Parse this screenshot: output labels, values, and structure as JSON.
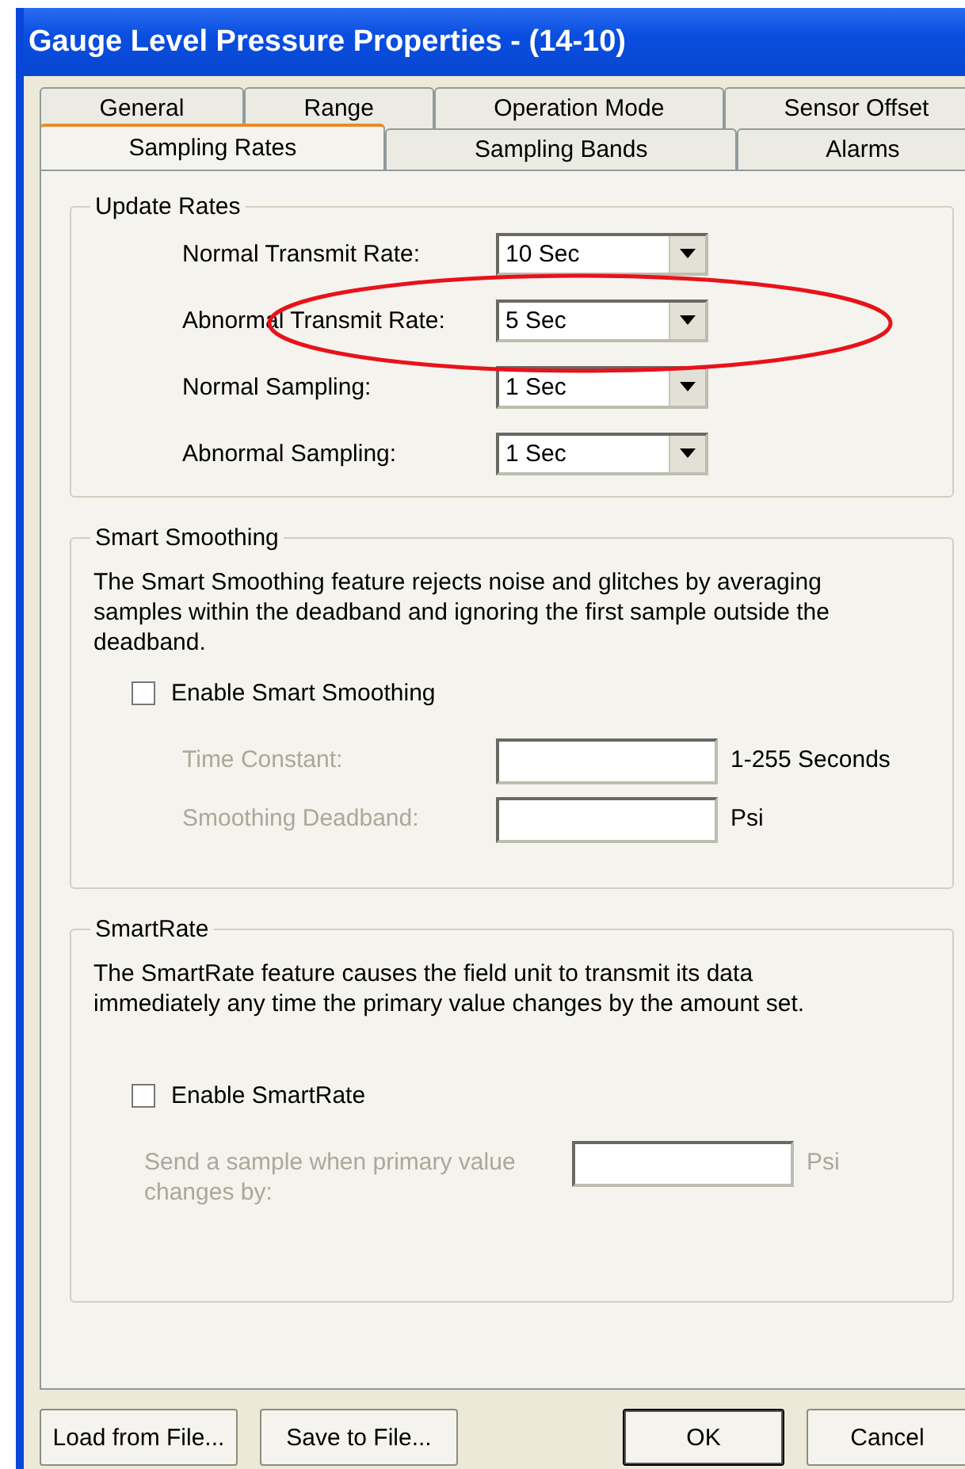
{
  "window": {
    "title": "Gauge Level Pressure Properties -  (14-10)"
  },
  "tab_rows": [
    {
      "tabs": [
        {
          "label": "General",
          "selected": false
        },
        {
          "label": "Range",
          "selected": false
        },
        {
          "label": "Operation Mode",
          "selected": false
        },
        {
          "label": "Sensor Offset",
          "selected": false
        }
      ]
    },
    {
      "tabs": [
        {
          "label": "Sampling Rates",
          "selected": true
        },
        {
          "label": "Sampling Bands",
          "selected": false
        },
        {
          "label": "Alarms",
          "selected": false
        }
      ]
    }
  ],
  "update_rates": {
    "title": "Update Rates",
    "rows": [
      {
        "label": "Normal Transmit Rate:",
        "value": "10 Sec"
      },
      {
        "label": "Abnormal Transmit Rate:",
        "value": "5 Sec"
      },
      {
        "label": "Normal Sampling:",
        "value": "1 Sec"
      },
      {
        "label": "Abnormal Sampling:",
        "value": "1 Sec"
      }
    ]
  },
  "smart_smoothing": {
    "title": "Smart Smoothing",
    "description": "The Smart Smoothing feature rejects noise and glitches by averaging samples within the deadband and ignoring the first sample outside the deadband.",
    "checkbox": {
      "label": "Enable Smart Smoothing",
      "checked": false
    },
    "fields": [
      {
        "label": "Time Constant:",
        "disabled": true,
        "unit": "1-255 Seconds",
        "unit_disabled": false
      },
      {
        "label": "Smoothing Deadband:",
        "disabled": true,
        "unit": "Psi",
        "unit_disabled": false
      }
    ]
  },
  "smart_rate": {
    "title": "SmartRate",
    "description": "The SmartRate feature causes the field unit to transmit its data immediately any time the primary value changes by the amount set.",
    "checkbox": {
      "label": "Enable SmartRate",
      "checked": false
    },
    "fields": [
      {
        "label": "Send a sample when primary value changes by:",
        "disabled": true,
        "unit": "Psi",
        "unit_disabled": true
      }
    ]
  },
  "buttons": [
    {
      "label": "Load from File...",
      "default": false
    },
    {
      "label": "Save to File...",
      "default": false
    },
    {
      "label": "OK",
      "default": true
    },
    {
      "label": "Cancel",
      "default": false
    }
  ]
}
